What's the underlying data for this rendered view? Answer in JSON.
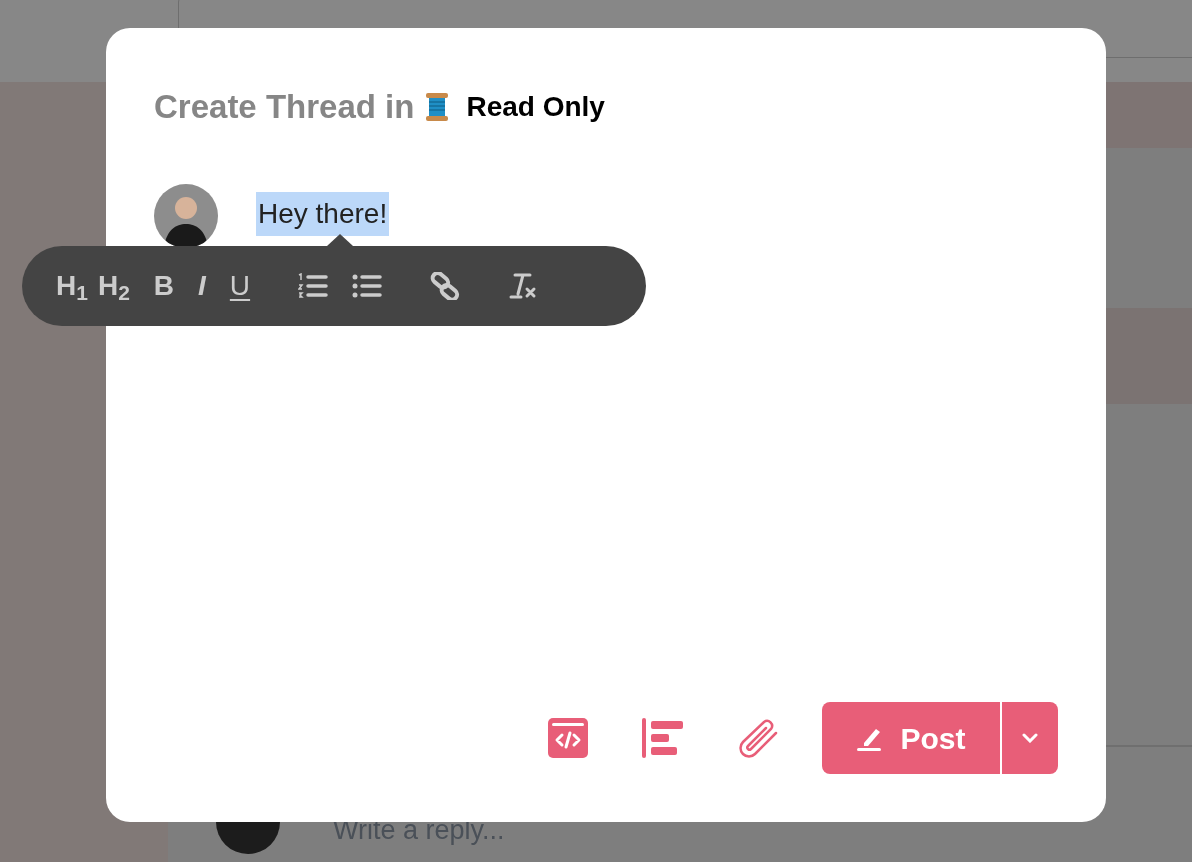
{
  "background": {
    "reply": {
      "placeholder": "Write a reply..."
    }
  },
  "dialog": {
    "title": "Create Thread in",
    "channel": "Read Only",
    "editor": {
      "text": "Hey there!",
      "selected": true
    },
    "format_toolbar": [
      {
        "kind": "heading",
        "label": "H$_{1}$"
      },
      {
        "kind": "heading",
        "label": "H$_{2}$"
      },
      {
        "kind": "bold",
        "label": "B"
      },
      {
        "kind": "italic",
        "label": "I"
      },
      {
        "kind": "underline",
        "label": "U"
      },
      {
        "kind": "ordered-list"
      },
      {
        "kind": "bullet-list"
      },
      {
        "kind": "link"
      },
      {
        "kind": "clear-format"
      }
    ],
    "actions": [
      {
        "kind": "code"
      },
      {
        "kind": "align"
      },
      {
        "kind": "attach"
      }
    ],
    "post_button": "Post"
  }
}
